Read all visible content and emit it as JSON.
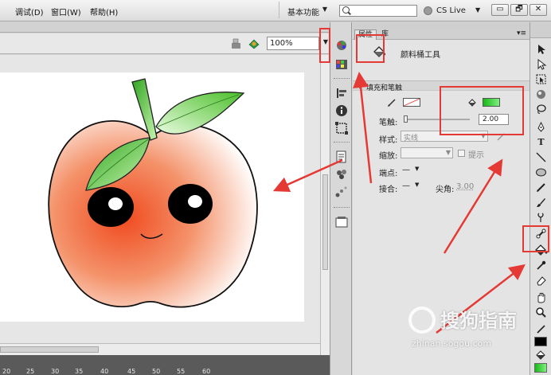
{
  "menu": {
    "items": [
      "调试(D)",
      "窗口(W)",
      "帮助(H)"
    ]
  },
  "topbar": {
    "workspace_label": "基本功能",
    "search_value": "",
    "cs_live_label": "CS Live",
    "window_buttons": [
      "▭",
      "🗗",
      "✕"
    ]
  },
  "stage_toolbar": {
    "zoom_value": "100%"
  },
  "ruler": {
    "labels": [
      "20",
      "25",
      "30",
      "35",
      "40",
      "45",
      "50",
      "55",
      "60"
    ]
  },
  "properties": {
    "tabs": [
      "属性",
      "库"
    ],
    "tool_name": "颜料桶工具",
    "section_title": "填充和笔触",
    "stroke_height_label": "笔触:",
    "stroke_height_value": "2.00",
    "style_label": "样式:",
    "style_value": "实线",
    "scale_label": "缩放:",
    "hint_label": "提示",
    "cap_label": "端点:",
    "cap_value": "—",
    "join_label": "接合:",
    "join_value": "—",
    "miter_label": "尖角:",
    "miter_value": "3.00"
  },
  "colors": {
    "stroke_swatch": "none",
    "fill_swatch": "#21c421",
    "annotation": "#e53935",
    "apple_red": "#f04a1f",
    "leaf_green": "#5cc832"
  },
  "tools": {
    "icons": [
      "selection-icon",
      "subselection-icon",
      "free-transform-icon",
      "3d-rotation-icon",
      "lasso-icon",
      "pen-icon",
      "text-icon",
      "line-icon",
      "oval-icon",
      "pencil-icon",
      "brush-icon",
      "deco-icon",
      "bone-icon",
      "paint-bucket-icon",
      "eyedropper-icon",
      "eraser-icon",
      "hand-icon",
      "zoom-icon",
      "stroke-color-icon",
      "fill-color-icon"
    ]
  },
  "watermark": {
    "title": "搜狗指南",
    "url": "zhinan.sogou.com"
  }
}
